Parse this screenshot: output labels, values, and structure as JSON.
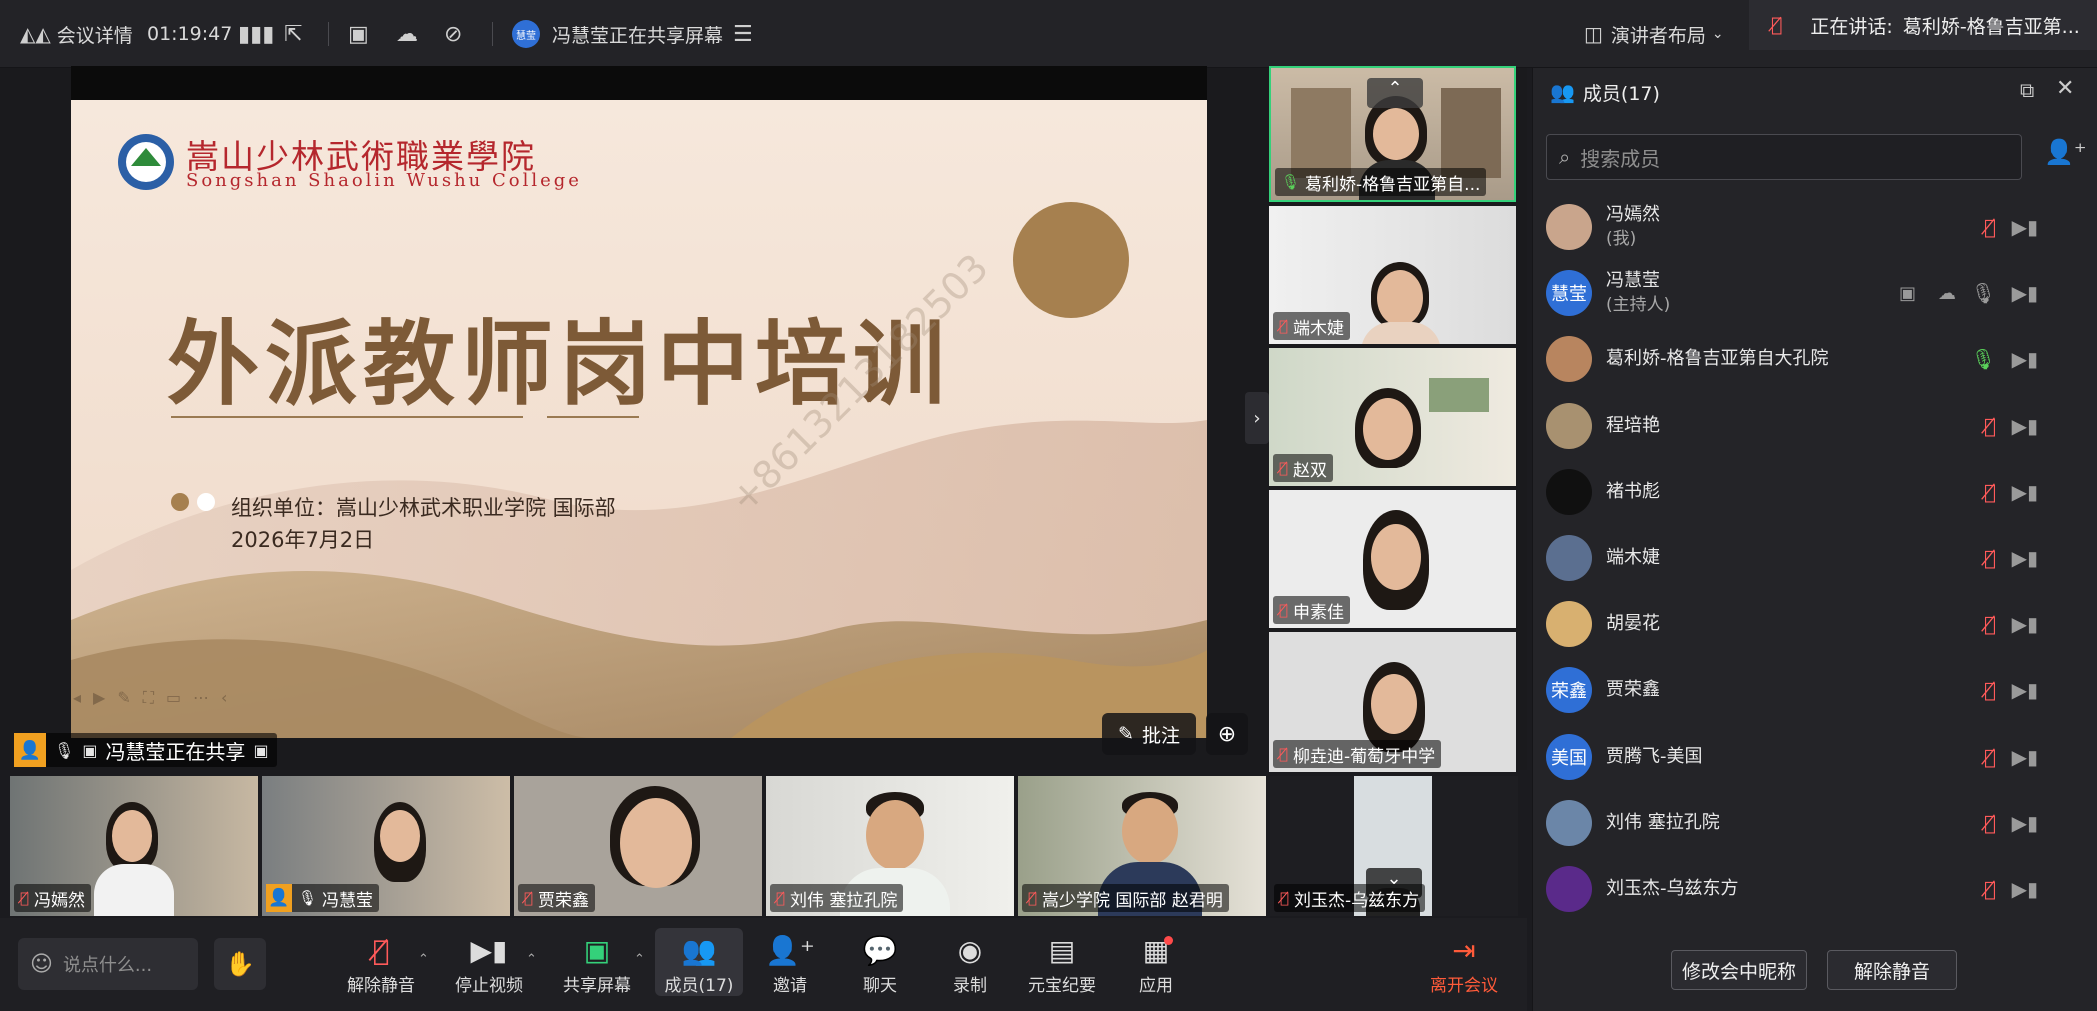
{
  "topbar": {
    "meeting_details": "会议详情",
    "elapsed": "01:19:47",
    "sharer_avatar": "慧莹",
    "sharing_status": "冯慧莹正在共享屏幕",
    "layout_label": "演讲者布局",
    "speaking_prefix": "正在讲话:",
    "speaking_name": "葛利娇-格鲁吉亚第..."
  },
  "slide": {
    "college_cn": "嵩山少林武術職業學院",
    "college_en": "Songshan Shaolin Wushu College",
    "title": "外派教师岗中培训",
    "org": "组织单位：嵩山少林武术职业学院 国际部",
    "date": "2026年7月2日",
    "watermark": "+8613213182503"
  },
  "stage": {
    "sharing_label": "冯慧莹正在共享",
    "annotate_label": "批注"
  },
  "right_videos": [
    {
      "name": "葛利娇-格鲁吉亚第自..."
    },
    {
      "name": "端木婕"
    },
    {
      "name": "赵双"
    },
    {
      "name": "申素佳"
    },
    {
      "name": "柳垚迪-葡萄牙中学"
    }
  ],
  "bottom_videos": [
    {
      "name": "冯嫣然"
    },
    {
      "name": "冯慧莹"
    },
    {
      "name": "贾荣鑫"
    },
    {
      "name": "刘伟  塞拉孔院"
    },
    {
      "name": "嵩少学院 国际部 赵君明"
    },
    {
      "name": "刘玉杰-乌兹东方"
    }
  ],
  "toolbar": {
    "chat_placeholder": "说点什么...",
    "buttons": [
      {
        "label": "解除静音"
      },
      {
        "label": "停止视频"
      },
      {
        "label": "共享屏幕"
      },
      {
        "label": "成员(17)"
      },
      {
        "label": "邀请"
      },
      {
        "label": "聊天"
      },
      {
        "label": "录制"
      },
      {
        "label": "元宝纪要"
      },
      {
        "label": "应用"
      },
      {
        "label": "离开会议"
      }
    ]
  },
  "panel": {
    "title": "成员(17)",
    "search_placeholder": "搜索成员",
    "rename_button": "修改会中昵称",
    "unmute_button": "解除静音",
    "members": [
      {
        "name": "冯嫣然",
        "sub": "(我)",
        "avatar": "",
        "color": "#c9a58c",
        "mic": "off"
      },
      {
        "name": "冯慧莹",
        "sub": "(主持人)",
        "avatar": "慧莹",
        "color": "#2f6fd6",
        "mic": "on-gray"
      },
      {
        "name": "葛利娇-格鲁吉亚第自大孔院",
        "sub": "",
        "avatar": "",
        "color": "#b8855f",
        "mic": "on"
      },
      {
        "name": "程培艳",
        "sub": "",
        "avatar": "",
        "color": "#a89170",
        "mic": "off"
      },
      {
        "name": "褚书彪",
        "sub": "",
        "avatar": "",
        "color": "#101010",
        "mic": "off"
      },
      {
        "name": "端木婕",
        "sub": "",
        "avatar": "",
        "color": "#5b6f90",
        "mic": "off"
      },
      {
        "name": "胡晏花",
        "sub": "",
        "avatar": "",
        "color": "#d8b070",
        "mic": "off"
      },
      {
        "name": "贾荣鑫",
        "sub": "",
        "avatar": "荣鑫",
        "color": "#2f6fd6",
        "mic": "off"
      },
      {
        "name": "贾腾飞-美国",
        "sub": "",
        "avatar": "美国",
        "color": "#2f6fd6",
        "mic": "off"
      },
      {
        "name": "刘伟  塞拉孔院",
        "sub": "",
        "avatar": "",
        "color": "#6b86a8",
        "mic": "off"
      },
      {
        "name": "刘玉杰-乌兹东方",
        "sub": "",
        "avatar": "",
        "color": "#5a2a8a",
        "mic": "off"
      }
    ]
  },
  "colors": {
    "accent_blue": "#2f6fd6",
    "mic_off_red": "#ff5a5a",
    "mic_on_green": "#5ad15a",
    "leave_red": "#ff5b3a",
    "active_tile_border": "#34d17a"
  }
}
